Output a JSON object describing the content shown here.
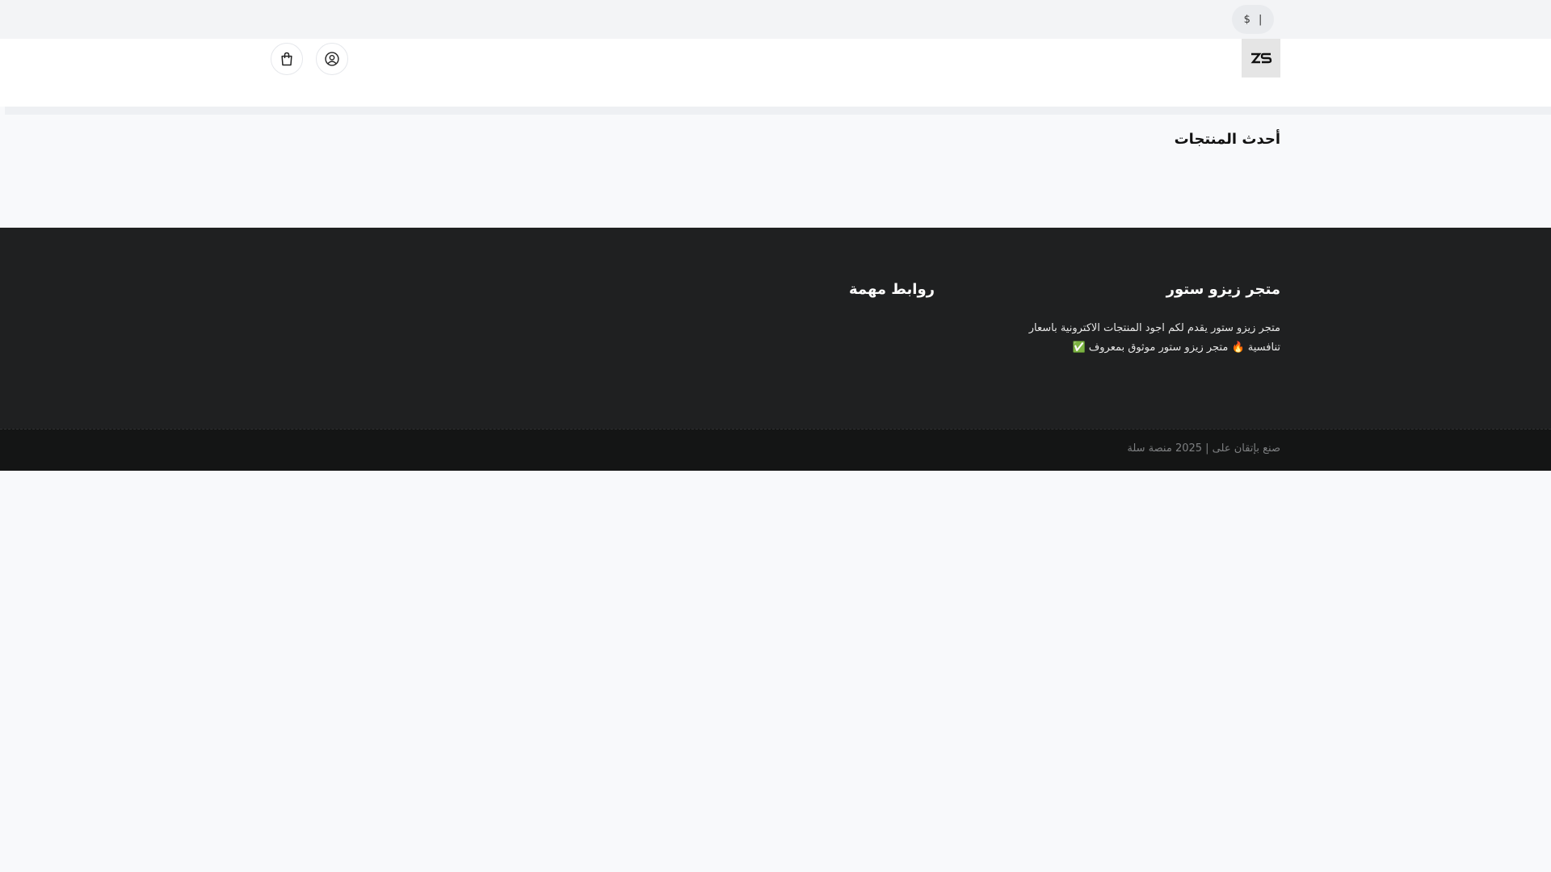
{
  "topbar": {
    "currency_symbol": "$",
    "separator": "|"
  },
  "header": {
    "logo_text": "ZS",
    "icons": {
      "account": "user-circle-icon",
      "cart": "shopping-bag-icon"
    }
  },
  "products": {
    "title": "أحدث المنتجات"
  },
  "footer": {
    "about_title": "متجر زيزو ستور",
    "about_line1": "متجر زيزو ستور يقدم لكم اجود المنتجات الاكترونية باسعار",
    "about_line2": "تنافسية 🔥 متجر زيزو ستور موثوق بمعروف ✅",
    "links_title": "روابط مهمة",
    "copyright": "صنع بإتقان على | 2025 منصة سلة"
  },
  "colors": {
    "page_bg": "#f8f9fb",
    "footer_bg": "#1f2021",
    "copyright_bg": "#141515"
  }
}
